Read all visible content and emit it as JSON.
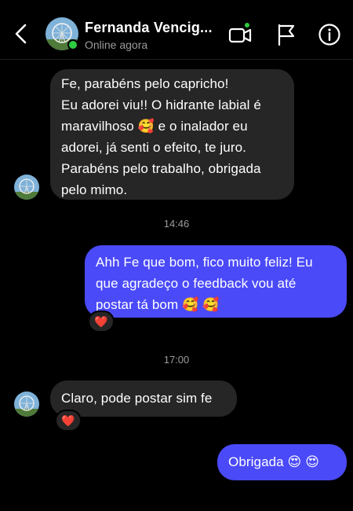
{
  "header": {
    "contact_name": "Fernanda Vencig...",
    "status": "Online agora"
  },
  "messages": {
    "m1": {
      "lines": [
        "Fe, parabéns pelo capricho!",
        "Eu adorei viu!! O hidrante labial é",
        "maravilhoso 🥰 e o inalador eu",
        "adorei, já senti o efeito, te juro.",
        "Parabéns pelo trabalho, obrigada",
        "pelo mimo."
      ]
    },
    "t1": "14:46",
    "m2": {
      "lines": [
        "Ahh Fe que bom, fico muito feliz! Eu",
        "que agradeço o feedback vou até",
        "postar tá bom 🥰 🥰"
      ],
      "reaction": "❤️"
    },
    "t2": "17:00",
    "m3": {
      "text": "Claro, pode postar sim fe",
      "reaction": "❤️"
    },
    "m4": {
      "text": "Obrigada 😍 😍"
    }
  },
  "icons": {
    "back": "chevron-left-icon",
    "video": "video-call-icon",
    "flag": "flag-icon",
    "info": "info-icon"
  },
  "colors": {
    "background": "#000000",
    "incoming_bubble": "#262626",
    "outgoing_bubble": "#4a4af9",
    "online": "#2ecc40"
  }
}
